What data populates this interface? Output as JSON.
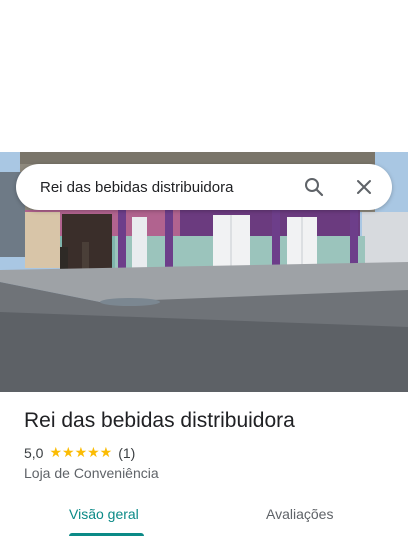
{
  "search": {
    "query": "Rei das bebidas distribuidora"
  },
  "place": {
    "name": "Rei das bebidas distribuidora",
    "rating": "5,0",
    "stars": "★★★★★",
    "review_count": "(1)",
    "category": "Loja de Conveniência"
  },
  "tabs": [
    {
      "label": "Visão geral",
      "active": true
    },
    {
      "label": "Avaliações",
      "active": false
    }
  ],
  "colors": {
    "accent": "#0b8a87",
    "stars": "#fbbc04"
  }
}
